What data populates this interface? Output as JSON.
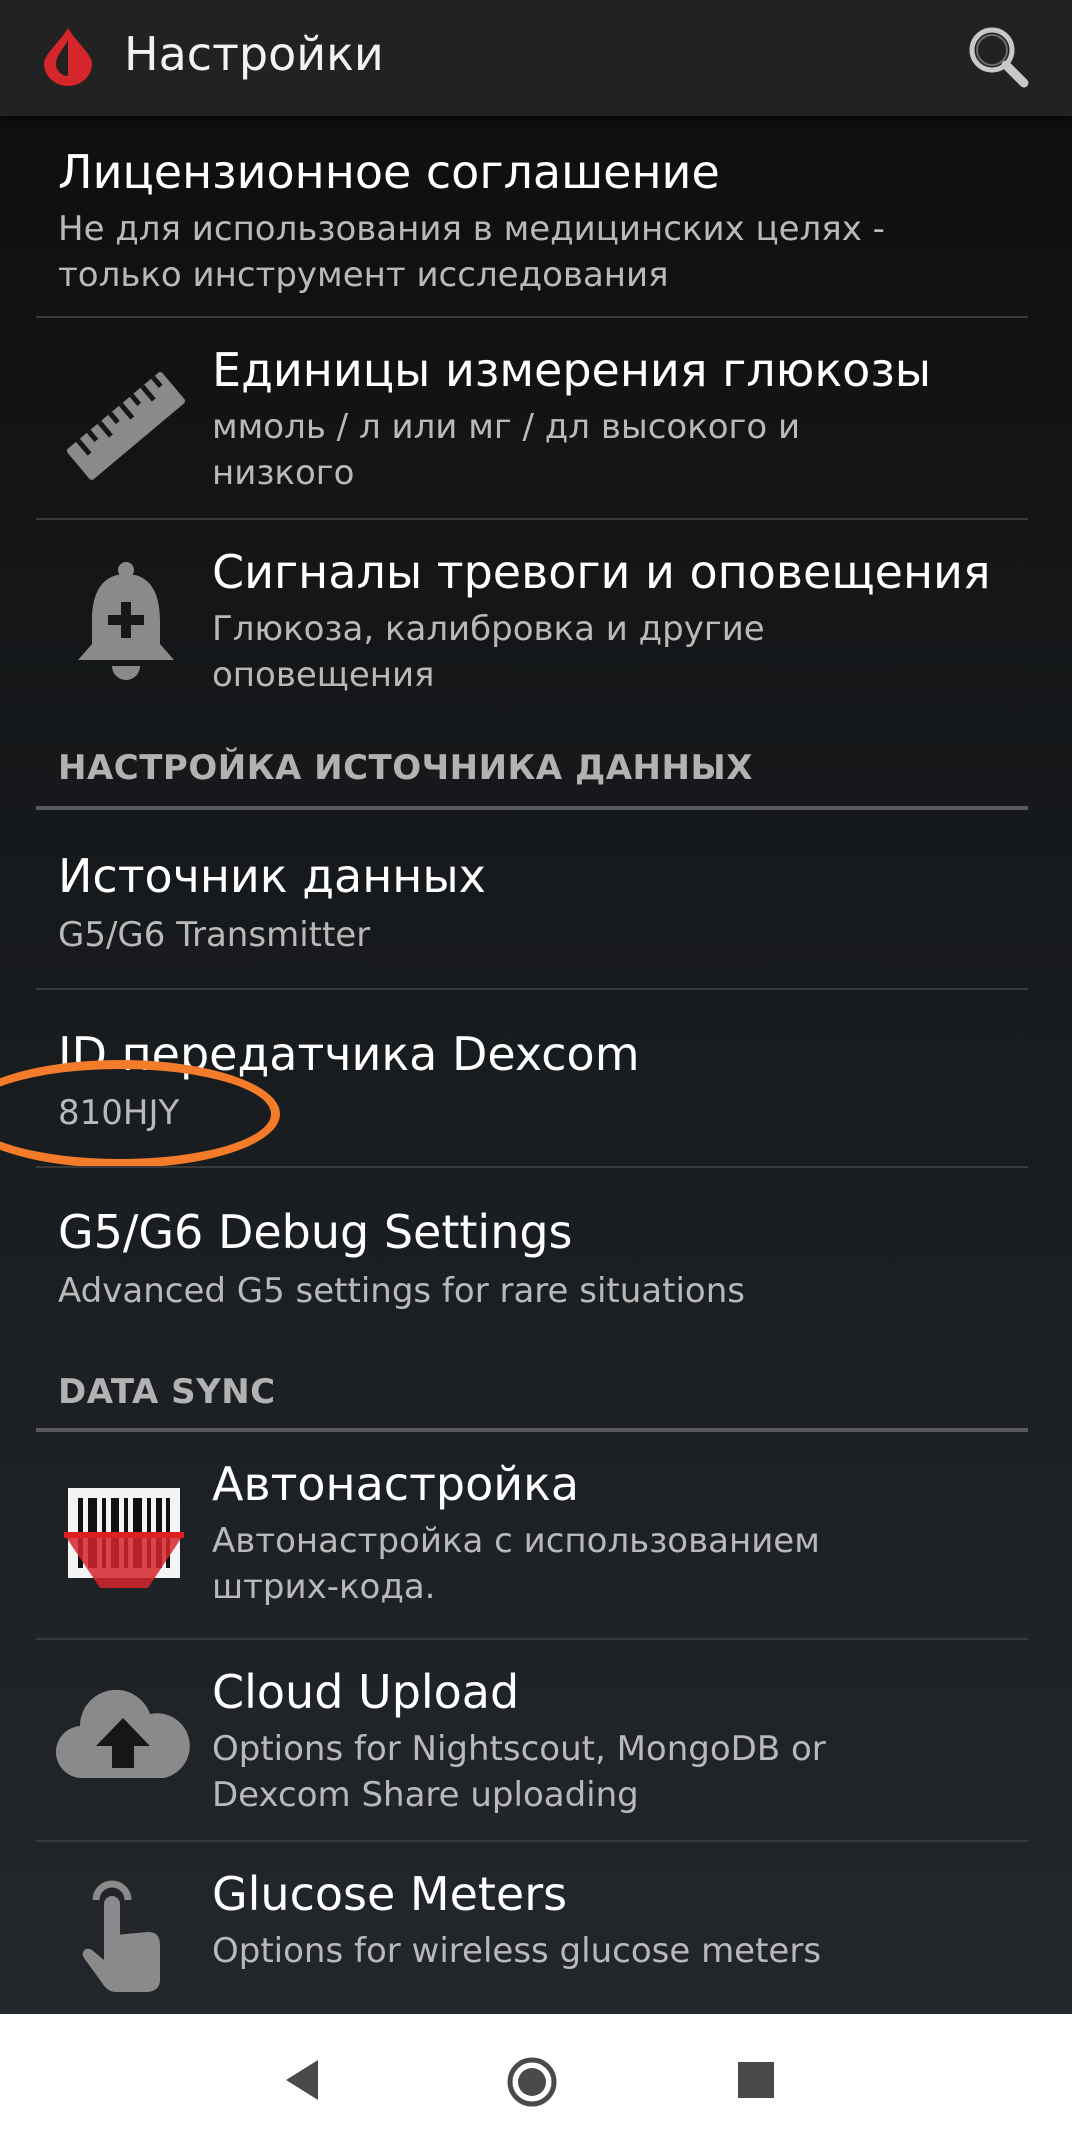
{
  "appbar": {
    "title": "Настройки",
    "logo_icon": "blood-drop-icon",
    "search_icon": "search-icon"
  },
  "items": {
    "license": {
      "title": "Лицензионное соглашение",
      "summary_line1": "Не для использования в медицинских целях -",
      "summary_line2": "только инструмент исследования"
    },
    "units": {
      "icon": "ruler-icon",
      "title": "Единицы измерения глюкозы",
      "summary_line1": "ммоль / л или мг / дл высокого и",
      "summary_line2": "низкого"
    },
    "alerts": {
      "icon": "alarm-bell-icon",
      "title": "Сигналы тревоги и оповещения",
      "summary_line1": "Глюкоза, калибровка и другие",
      "summary_line2": "оповещения"
    }
  },
  "categories": {
    "data_source": "НАСТРОЙКА ИСТОЧНИКА ДАННЫХ",
    "data_sync": "DATA SYNC"
  },
  "data_source": {
    "source": {
      "title": "Источник данных",
      "summary": "G5/G6 Transmitter"
    },
    "transmitter_id": {
      "title": "ID передатчика Dexcom",
      "summary": "810HJY"
    },
    "debug": {
      "title": "G5/G6 Debug Settings",
      "summary": "Advanced G5 settings for rare situations"
    }
  },
  "data_sync": {
    "auto_setup": {
      "icon": "barcode-scanner-icon",
      "title": "Автонастройка",
      "summary_line1": "Автонастройка с использованием",
      "summary_line2": "штрих-кода."
    },
    "cloud_upload": {
      "icon": "cloud-upload-icon",
      "title": "Cloud Upload",
      "summary_line1": "Options for Nightscout, MongoDB or",
      "summary_line2": "Dexcom Share uploading"
    },
    "glucose_meters": {
      "icon": "hand-pointer-icon",
      "title": "Glucose Meters",
      "summary": "Options for wireless glucose meters"
    }
  },
  "annotation": {
    "color": "#f47b2a"
  },
  "colors": {
    "accent_red": "#d4262b",
    "icon_gray": "#8a8a8a"
  },
  "navbar": {
    "back_icon": "back-triangle-icon",
    "home_icon": "home-circle-icon",
    "recent_icon": "recent-square-icon"
  }
}
